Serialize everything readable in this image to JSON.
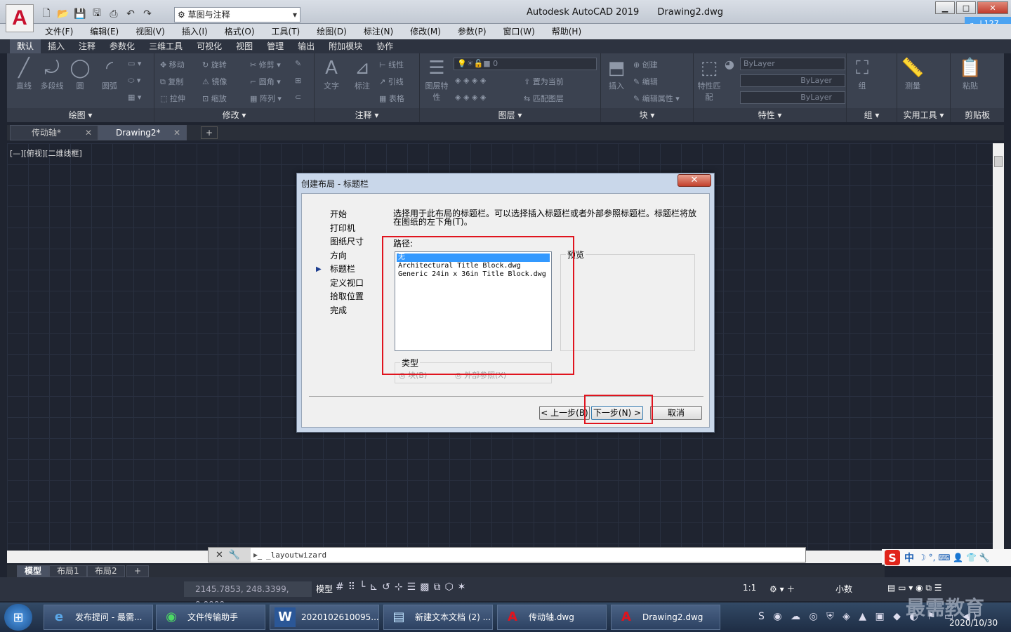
{
  "title_bar": {
    "app_name": "Autodesk AutoCAD 2019",
    "document": "Drawing2.dwg",
    "workspace": "草图与注释",
    "logo_letter": "A",
    "window_buttons": {
      "minimize": "▁",
      "maximize": "□",
      "close": "✕"
    },
    "cloud_widget": "127"
  },
  "menu": [
    "文件(F)",
    "编辑(E)",
    "视图(V)",
    "插入(I)",
    "格式(O)",
    "工具(T)",
    "绘图(D)",
    "标注(N)",
    "修改(M)",
    "参数(P)",
    "窗口(W)",
    "帮助(H)"
  ],
  "ribbon_tabs": [
    "默认",
    "插入",
    "注释",
    "参数化",
    "三维工具",
    "可视化",
    "视图",
    "管理",
    "输出",
    "附加模块",
    "协作"
  ],
  "ribbon": {
    "draw": {
      "title": "绘图 ▾",
      "tools": [
        "直线",
        "多段线",
        "圆",
        "圆弧"
      ]
    },
    "modify": {
      "title": "修改 ▾",
      "tools": [
        "移动",
        "旋转",
        "修剪",
        "复制",
        "镜像",
        "圆角",
        "拉伸",
        "缩放",
        "阵列"
      ]
    },
    "annotation": {
      "title": "注释 ▾",
      "tools": [
        "文字",
        "标注",
        "线性",
        "引线",
        "表格"
      ]
    },
    "layers": {
      "title": "图层 ▾",
      "tools": [
        "图层特性",
        "置为当前",
        "匹配图层"
      ],
      "current_layer": "0"
    },
    "block": {
      "title": "块 ▾",
      "tools": [
        "插入",
        "创建",
        "编辑",
        "编辑属性"
      ]
    },
    "properties": {
      "title": "特性 ▾",
      "tools": [
        "特性匹配"
      ],
      "bylayer": [
        "ByLayer",
        "ByLayer",
        "ByLayer"
      ]
    },
    "groups": {
      "title": "组 ▾",
      "tools": [
        "组"
      ]
    },
    "utilities": {
      "title": "实用工具 ▾",
      "tools": [
        "测量"
      ]
    },
    "clipboard": {
      "title": "剪贴板",
      "tools": [
        "粘贴"
      ]
    }
  },
  "doc_tabs": [
    {
      "label": "传动轴*",
      "close": "✕"
    },
    {
      "label": "Drawing2*",
      "close": "✕"
    }
  ],
  "doc_tab_add": "+",
  "viewport_label": "[—][俯视][二维线框]",
  "command_line": {
    "prompt": "_layoutwizard"
  },
  "layout_tabs": [
    "模型",
    "布局1",
    "布局2"
  ],
  "layout_tab_add": "+",
  "status_bar": {
    "coordinates": "2145.7853, 248.3399, 0.0000",
    "model_label": "模型",
    "scale": "1:1",
    "units": "小数"
  },
  "ime": {
    "logo": "S",
    "lang": "中"
  },
  "taskbar": {
    "items": [
      {
        "label": "发布提问 - 最需...",
        "icon": "ie-icon"
      },
      {
        "label": "文件传输助手",
        "icon": "wechat-icon"
      },
      {
        "label": "2020102610095...",
        "icon": "word-icon"
      },
      {
        "label": "新建文本文档 (2) ...",
        "icon": "notepad-icon"
      },
      {
        "label": "传动轴.dwg",
        "icon": "autocad-icon"
      },
      {
        "label": "Drawing2.dwg",
        "icon": "autocad-icon"
      }
    ],
    "clock_date": "2020/10/30",
    "watermark": "最需教育"
  },
  "dialog": {
    "title": "创建布局 - 标题栏",
    "steps": [
      "开始",
      "打印机",
      "图纸尺寸",
      "方向",
      "标题栏",
      "定义视口",
      "拾取位置",
      "完成"
    ],
    "current_step": 4,
    "description": "选择用于此布局的标题栏。可以选择插入标题栏或者外部参照标题栏。标题栏将放在图纸的左下角(T)。",
    "path_label": "路径:",
    "title_blocks": [
      "无",
      "Architectural Title Block.dwg",
      "Generic 24in x 36in Title Block.dwg"
    ],
    "selected_index": 0,
    "preview_label": "预览",
    "type_label": "类型",
    "type_options": [
      "块(B)",
      "外部参照(X)"
    ],
    "buttons": {
      "back": "< 上一步(B)",
      "next": "下一步(N) >",
      "cancel": "取消"
    },
    "close": "✕"
  },
  "colors": {
    "highlight": "#e0141e",
    "selection": "#3399ff",
    "canvas": "#1f2430"
  }
}
